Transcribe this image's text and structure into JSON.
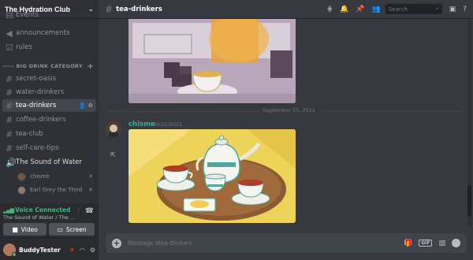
{
  "server": {
    "name": "The Hydration Club"
  },
  "channels_top": [
    {
      "label": "Events",
      "icon": "rules-icon"
    },
    {
      "label": "announcements",
      "icon": "megaphone-icon"
    },
    {
      "label": "rules",
      "icon": "checklist-icon"
    }
  ],
  "category": {
    "label": "----- BIG DRINK CATEGORY"
  },
  "channels": [
    {
      "label": "secret-oasis"
    },
    {
      "label": "water-drinkers"
    },
    {
      "label": "tea-drinkers"
    },
    {
      "label": "coffee-drinkers"
    },
    {
      "label": "tea-club"
    },
    {
      "label": "self-care-tips"
    }
  ],
  "voice_channel": {
    "label": "The Sound of Water"
  },
  "voice_users": [
    {
      "name": "chisme"
    },
    {
      "name": "Earl Grey the Third"
    }
  ],
  "voice_panel": {
    "status": "Voice Connected",
    "subtitle": "The Sound of Water / The ...",
    "video_label": "Video",
    "screen_label": "Screen"
  },
  "user": {
    "name": "BuddyTester"
  },
  "topbar": {
    "channel": "tea-drinkers",
    "search_placeholder": "Search"
  },
  "divider": {
    "date": "September 25, 2021"
  },
  "message": {
    "author": "chisme",
    "timestamp": "09/25/2021"
  },
  "composer": {
    "placeholder": "Message #tea-drinkers",
    "gif_label": "GIF"
  },
  "colors": {
    "accent_green": "#43b581",
    "author_teal": "#1abc9c",
    "background": "#36393f",
    "sidebar": "#2f3136"
  }
}
